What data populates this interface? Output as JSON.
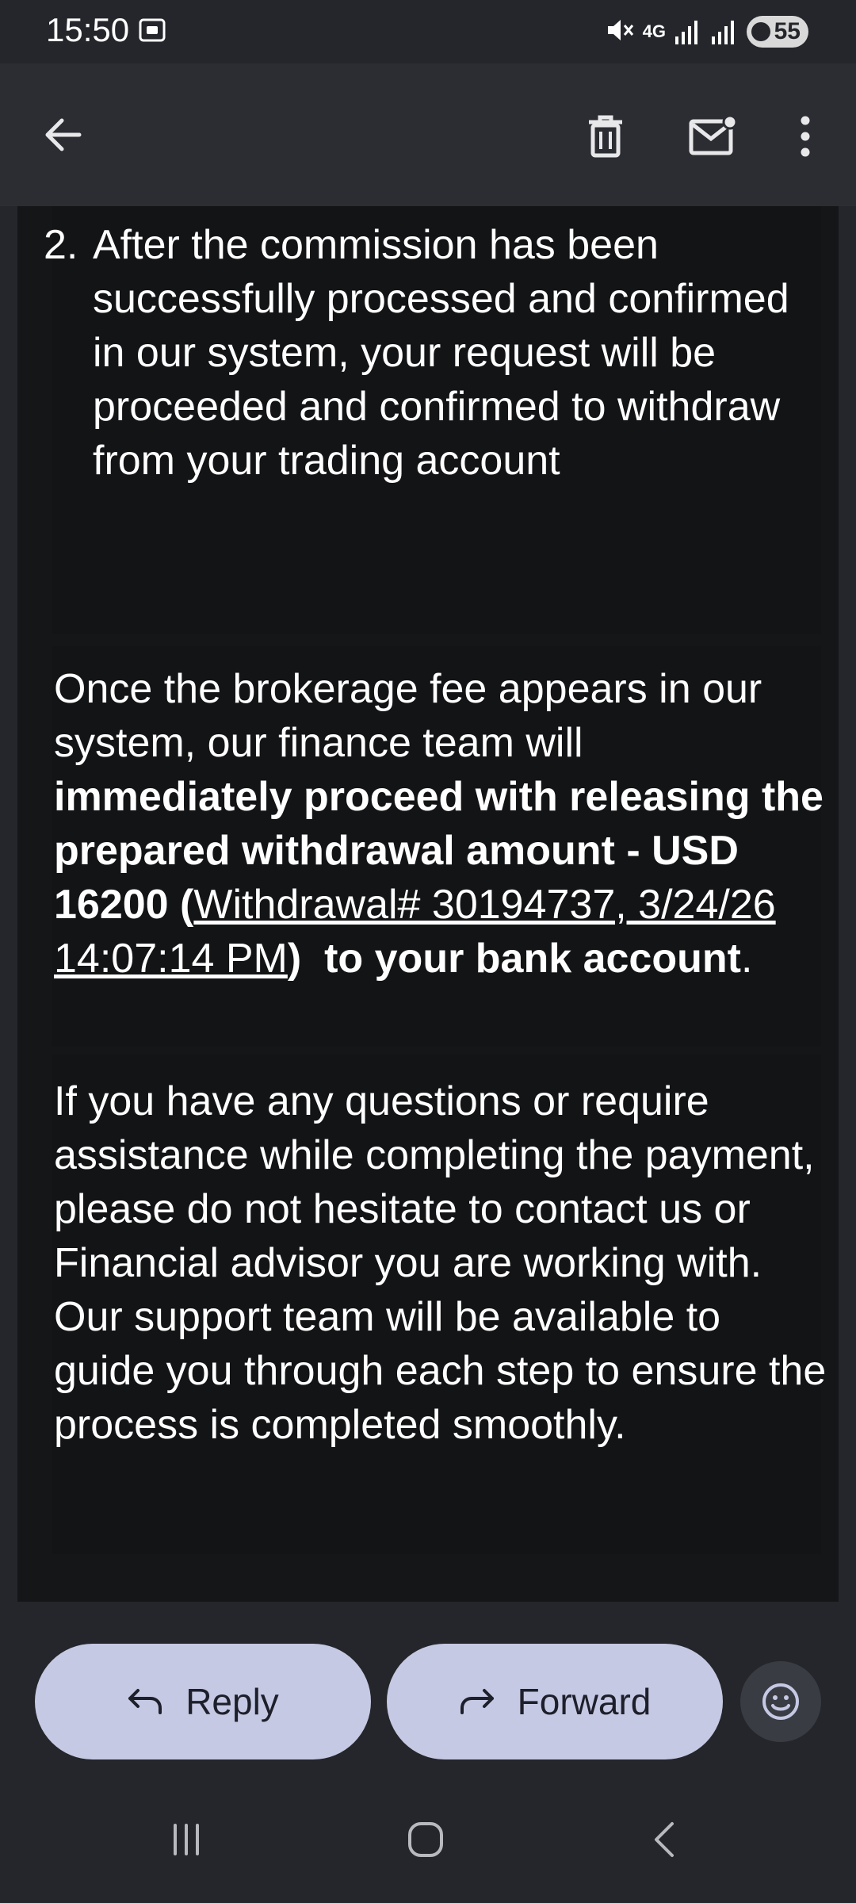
{
  "status_bar": {
    "time": "15:50",
    "network": "4G",
    "battery": "55"
  },
  "toolbar": {
    "back_icon": "arrow-left-icon",
    "delete_icon": "trash-icon",
    "mark_unread_icon": "mail-unread-icon",
    "more_icon": "more-vert-icon"
  },
  "email": {
    "list_item_number": "2.",
    "list_item_text": "After the commission has been successfully processed and confirmed in our system, your request will be proceeded and confirmed to withdraw from your trading account",
    "para1": {
      "plain1": "Once the brokerage fee appears in our system, our finance team will ",
      "bold1": "immediately proceed with releasing the prepared withdrawal amount - USD 16200 (",
      "link": "Withdrawal# 30194737, 3/24/26 14:07:14 PM",
      "bold2": ")",
      "bold3": "to your bank account",
      "end": "."
    },
    "para2": "If you have any questions or require assistance while completing the payment, please do not hesitate to contact us or Financial advisor you are working with. Our support team will be available to guide you through each step to ensure the process is completed smoothly."
  },
  "actions": {
    "reply_label": "Reply",
    "forward_label": "Forward",
    "emoji_icon": "emoji-icon"
  },
  "colors": {
    "background": "#24262b",
    "card": "#151618",
    "button": "#c6c9e3"
  }
}
